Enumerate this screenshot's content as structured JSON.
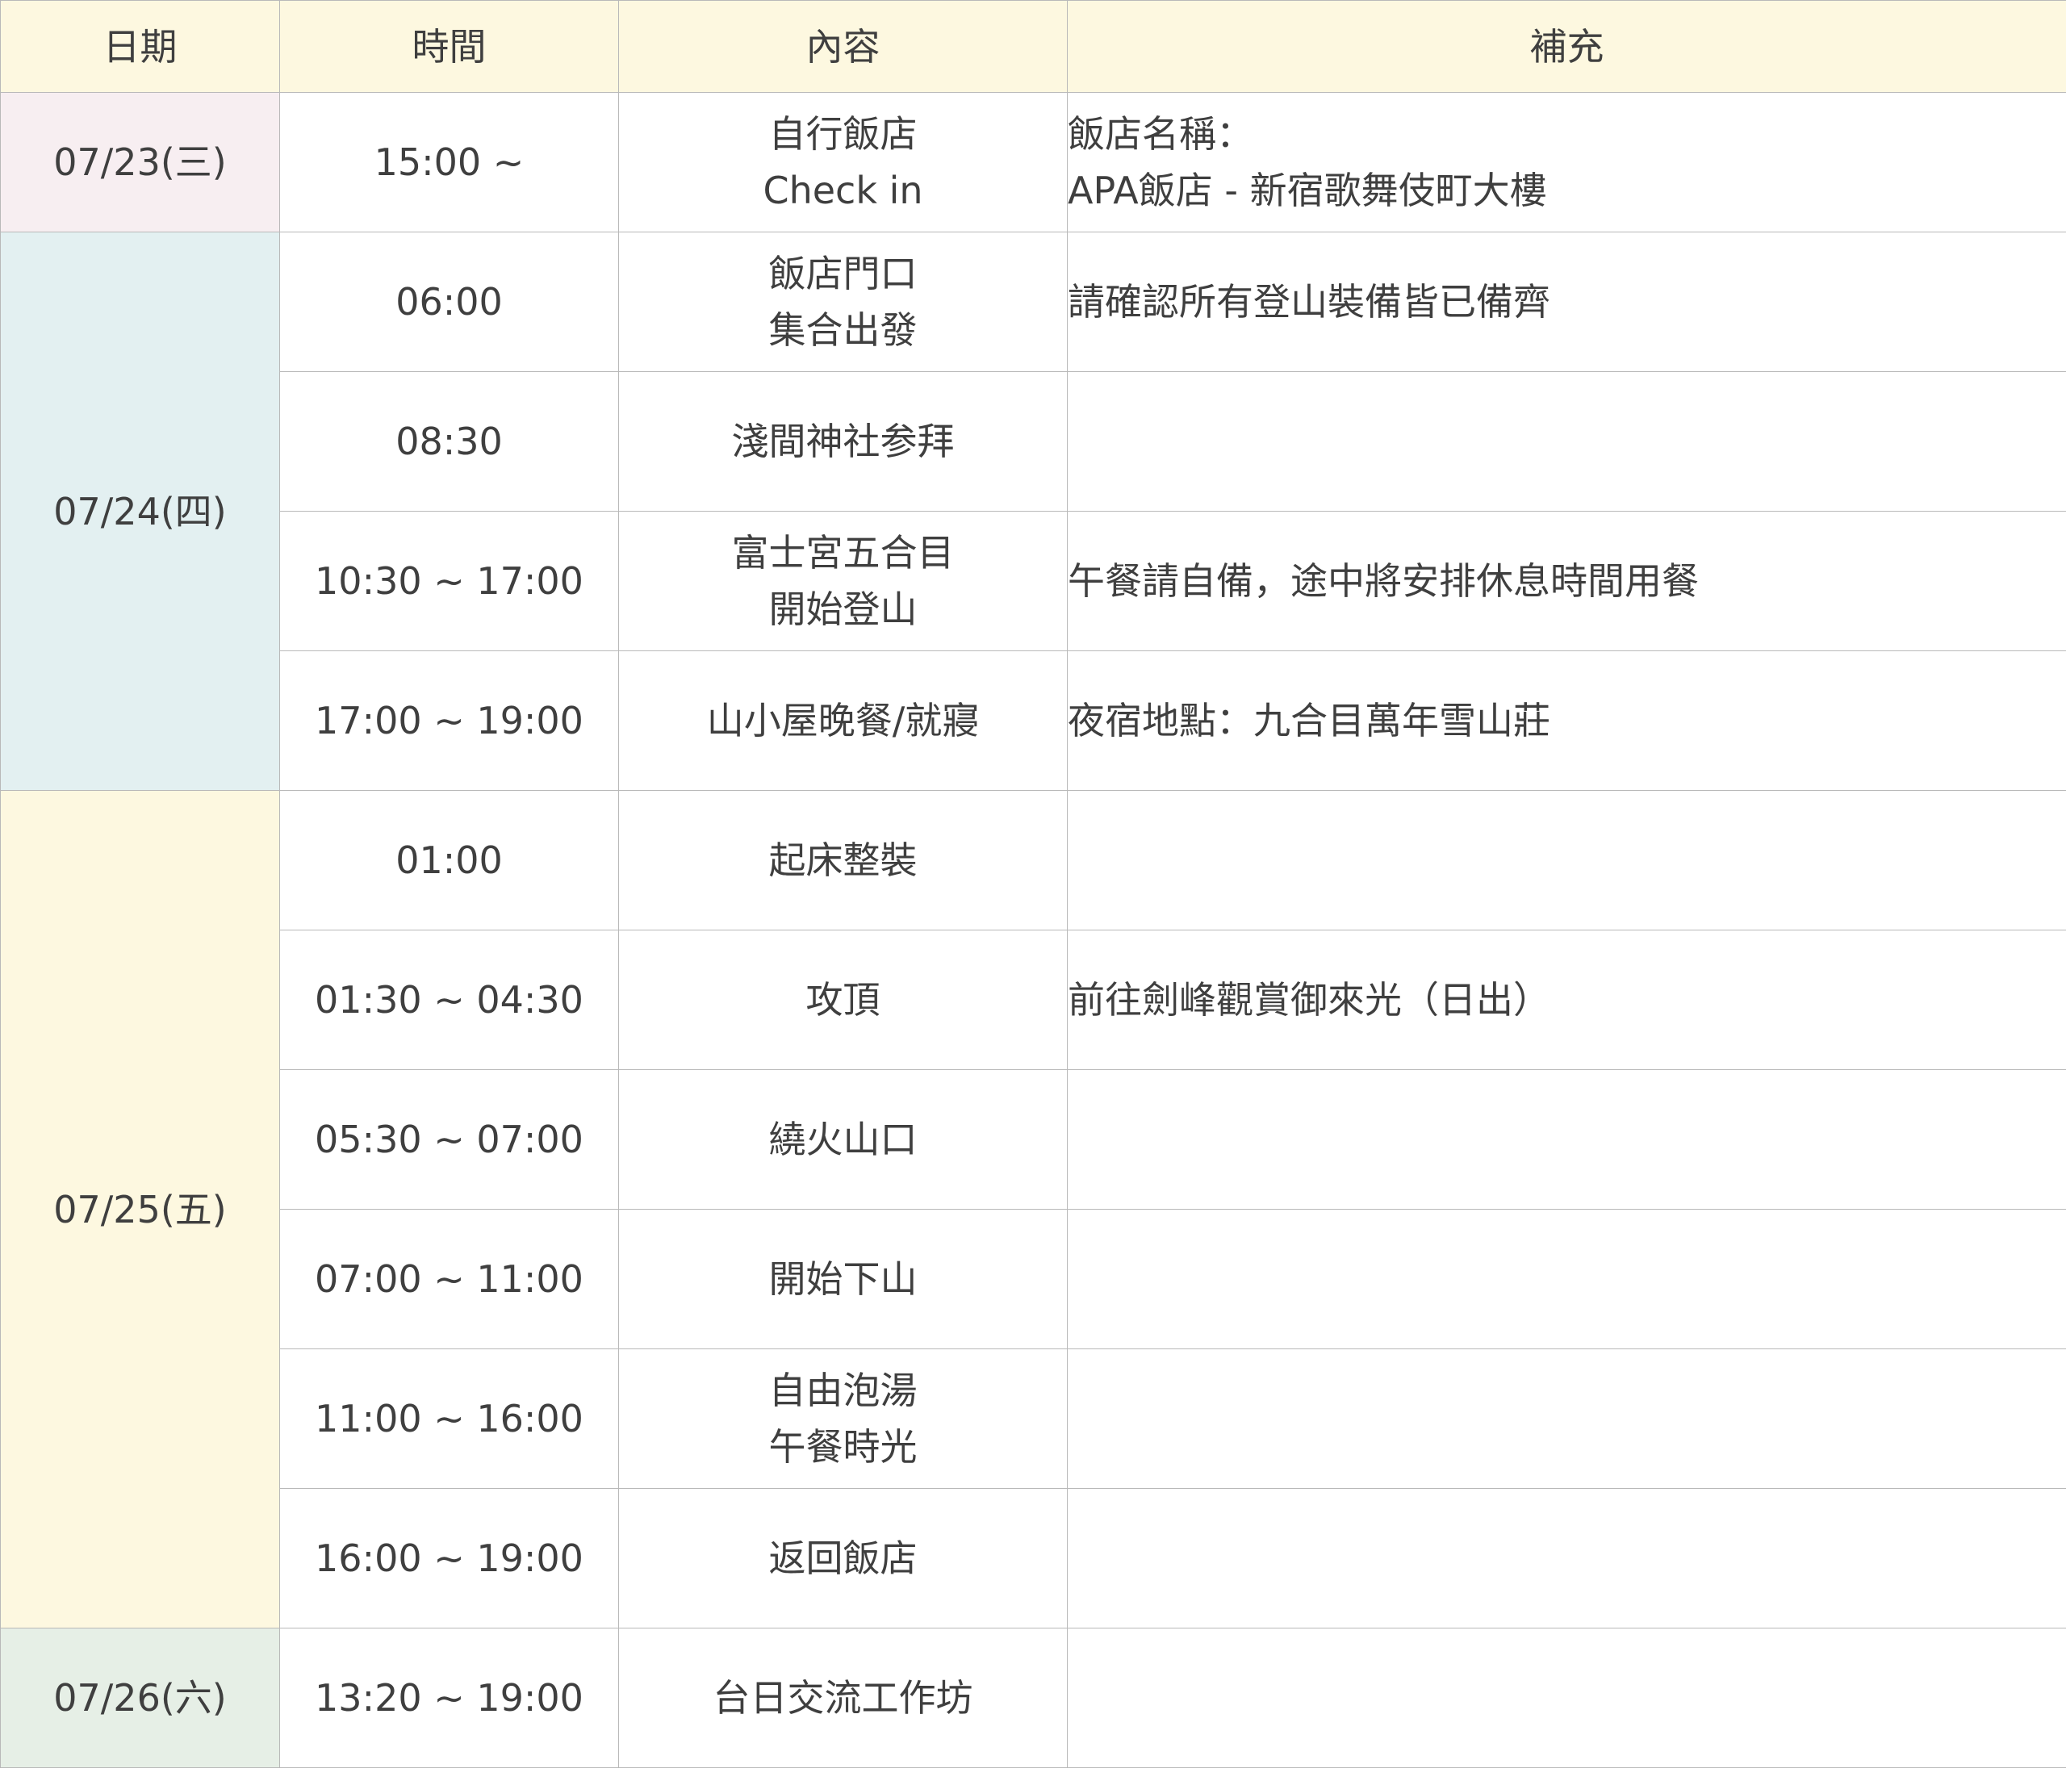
{
  "headers": {
    "date": "日期",
    "time": "時間",
    "content": "內容",
    "note": "補充"
  },
  "colors": {
    "header_bg": "#fdf8e0",
    "day1_bg": "#f7eef1",
    "day2_bg": "#e3f0f1",
    "day3_bg": "#fdf8e0",
    "day4_bg": "#e6efe6",
    "border": "#b9b9b9",
    "text": "#3f3f3f"
  },
  "days": [
    {
      "date": "07/23(三)"
    },
    {
      "date": "07/24(四)"
    },
    {
      "date": "07/25(五)"
    },
    {
      "date": "07/26(六)"
    }
  ],
  "rows": [
    {
      "time": "15:00 ~",
      "content": [
        "自行飯店",
        "Check in"
      ],
      "note": [
        "飯店名稱：",
        "APA飯店 - 新宿歌舞伎町大樓"
      ]
    },
    {
      "time": "06:00",
      "content": [
        "飯店門口",
        "集合出發"
      ],
      "note": [
        "請確認所有登山裝備皆已備齊"
      ]
    },
    {
      "time": "08:30",
      "content": [
        "淺間神社参拜"
      ],
      "note": []
    },
    {
      "time": "10:30 ~ 17:00",
      "content": [
        "富士宮五合目",
        "開始登山"
      ],
      "note": [
        "午餐請自備，途中將安排休息時間用餐"
      ]
    },
    {
      "time": "17:00 ~ 19:00",
      "content": [
        "山小屋晚餐/就寢"
      ],
      "note": [
        "夜宿地點：九合目萬年雪山莊"
      ]
    },
    {
      "time": "01:00",
      "content": [
        "起床整裝"
      ],
      "note": []
    },
    {
      "time": "01:30 ~ 04:30",
      "content": [
        "攻頂"
      ],
      "note": [
        "前往劍峰觀賞御來光（日出）"
      ]
    },
    {
      "time": "05:30 ~ 07:00",
      "content": [
        "繞火山口"
      ],
      "note": []
    },
    {
      "time": "07:00 ~ 11:00",
      "content": [
        "開始下山"
      ],
      "note": []
    },
    {
      "time": "11:00 ~ 16:00",
      "content": [
        "自由泡湯",
        "午餐時光"
      ],
      "note": []
    },
    {
      "time": "16:00 ~ 19:00",
      "content": [
        "返回飯店"
      ],
      "note": []
    },
    {
      "time": "13:20 ~ 19:00",
      "content": [
        "台日交流工作坊"
      ],
      "note": []
    }
  ]
}
